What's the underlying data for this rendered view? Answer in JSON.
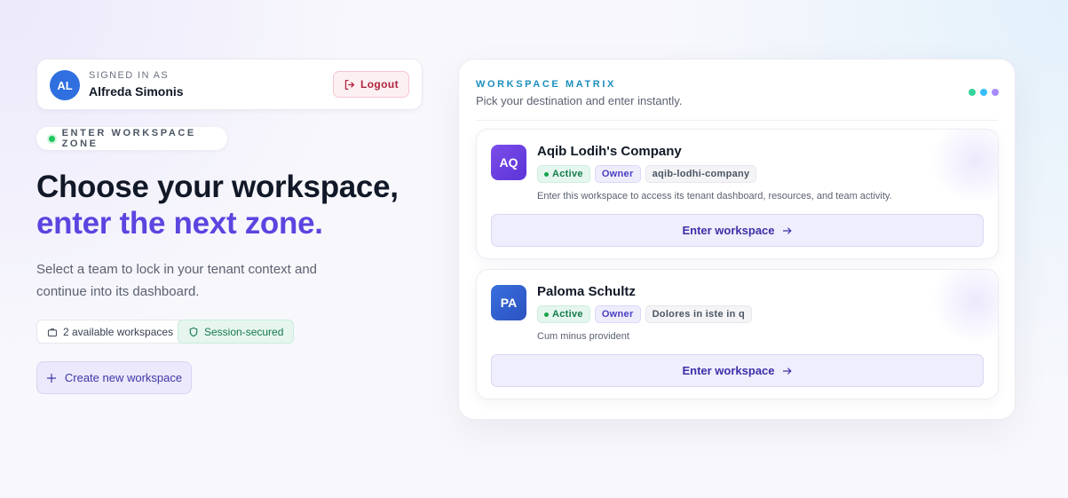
{
  "session": {
    "avatar_initials": "AL",
    "label": "SIGNED IN AS",
    "user_name": "Alfreda Simonis",
    "logout_label": "Logout"
  },
  "hero": {
    "zone_label": "ENTER WORKSPACE ZONE",
    "headline_line1": "Choose your workspace,",
    "headline_line2": "enter the next zone.",
    "subtext": "Select a team to lock in your tenant context and continue into its dashboard.",
    "available_chip": "2 available workspaces",
    "secured_chip": "Session-secured",
    "create_label": "Create new workspace"
  },
  "panel": {
    "kicker": "WORKSPACE MATRIX",
    "subtitle": "Pick your destination and enter instantly.",
    "dot_colors": [
      "#34d399",
      "#38bdf8",
      "#a78bfa"
    ],
    "workspaces": [
      {
        "initials": "AQ",
        "avatar_color": "#6d3fe0",
        "name": "Aqib Lodih's Company",
        "status": "Active",
        "role": "Owner",
        "slug": "aqib-lodhi-company",
        "description": "Enter this workspace to access its tenant dashboard, resources, and team activity.",
        "enter_label": "Enter workspace"
      },
      {
        "initials": "PA",
        "avatar_color": "#2f5fcf",
        "name": "Paloma Schultz",
        "status": "Active",
        "role": "Owner",
        "slug": "Dolores in iste in q",
        "description": "Cum minus provident",
        "enter_label": "Enter workspace"
      }
    ]
  }
}
